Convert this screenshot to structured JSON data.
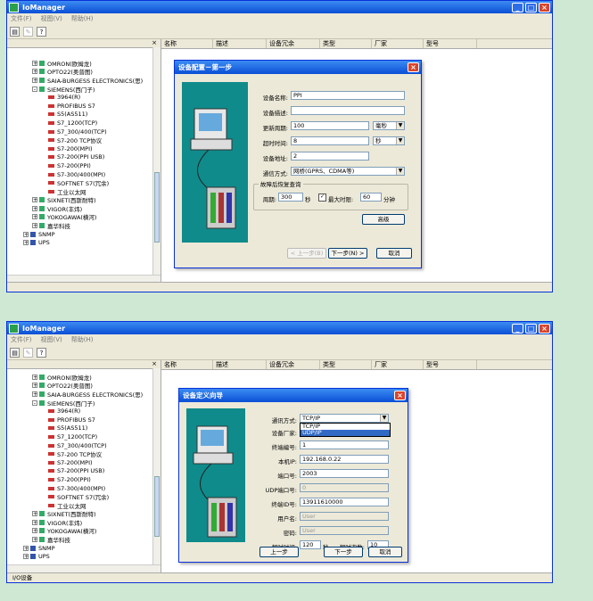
{
  "app": {
    "title": "IoManager"
  },
  "menu": [
    "文件(F)",
    "视图(V)",
    "帮助(H)"
  ],
  "columns": [
    "名称",
    "描述",
    "设备冗余",
    "类型",
    "厂家",
    "型号"
  ],
  "tree": {
    "close_btn": "×",
    "items": [
      {
        "label": "OMRON(欧姆龙)",
        "level": 1,
        "exp": "+"
      },
      {
        "label": "OPTO22(奥普图)",
        "level": 1,
        "exp": "+"
      },
      {
        "label": "SAIA-BURGESS ELECTRONICS(思)",
        "level": 1,
        "exp": "+"
      },
      {
        "label": "SIEMENS(西门子)",
        "level": 1,
        "exp": "-"
      },
      {
        "label": "3964(R)",
        "level": 2
      },
      {
        "label": "PROFIBUS S7",
        "level": 2
      },
      {
        "label": "S5(AS511)",
        "level": 2
      },
      {
        "label": "S7_1200(TCP)",
        "level": 2
      },
      {
        "label": "S7_300/400(TCP)",
        "level": 2
      },
      {
        "label": "S7-200 TCP协议",
        "level": 2
      },
      {
        "label": "S7-200(MPI)",
        "level": 2
      },
      {
        "label": "S7-200(PPI USB)",
        "level": 2
      },
      {
        "label": "S7-200(PPI)",
        "level": 2
      },
      {
        "label": "S7-300/400(MPI)",
        "level": 2
      },
      {
        "label": "SOFTNET S7(冗余)",
        "level": 2
      },
      {
        "label": "工业以太网",
        "level": 2
      },
      {
        "label": "SIXNET(西斯耐特)",
        "level": 1,
        "exp": "+"
      },
      {
        "label": "VIGOR(丰炜)",
        "level": 1,
        "exp": "+"
      },
      {
        "label": "YOKOGAWA(横河)",
        "level": 1,
        "exp": "+"
      },
      {
        "label": "嘉华科技",
        "level": 1,
        "exp": "+"
      },
      {
        "label": "SNMP",
        "level": 0,
        "exp": "+"
      },
      {
        "label": "UPS",
        "level": 0,
        "exp": "+"
      }
    ]
  },
  "dialog1": {
    "title": "设备配置－第一步",
    "name_label": "设备名称:",
    "name_value": "PPI",
    "desc_label": "设备描述:",
    "desc_value": "",
    "cycle_label": "更新周期:",
    "cycle_value": "100",
    "cycle_unit": "毫秒",
    "timeout_label": "超时时间:",
    "timeout_value": "8",
    "timeout_unit": "秒",
    "addr_label": "设备地址:",
    "addr_value": "2",
    "comm_label": "通信方式:",
    "comm_value": "网桥(GPRS、CDMA等)",
    "group_label": "故障后恢复查询",
    "period_label": "周期:",
    "period_value": "300",
    "period_unit": "秒",
    "maxtime_label": "最大时限:",
    "maxtime_value": "60",
    "maxtime_unit": "分钟",
    "advanced_btn": "高级",
    "prev_btn": "< 上一步(B)",
    "next_btn": "下一步(N) >",
    "cancel_btn": "取消"
  },
  "dialog2": {
    "title": "设备定义向导",
    "comm_label": "通讯方式:",
    "comm_value": "TCP/IP",
    "comm_options": [
      "TCP/IP",
      "UDP/IP"
    ],
    "vendor_label": "设备厂家:",
    "term_no_label": "终端编号:",
    "term_no_value": "1",
    "local_ip_label": "本机IP:",
    "local_ip_value": "192.168.0.22",
    "port_label": "端口号:",
    "port_value": "2003",
    "udp_port_label": "UDP端口号:",
    "udp_port_value": "0",
    "term_id_label": "终端ID号:",
    "term_id_value": "13911610000",
    "user_label": "用户名:",
    "user_value": "User",
    "pwd_label": "密码:",
    "pwd_value": "User",
    "timeout_label": "超时时间:",
    "timeout_value": "120",
    "timeout_unit": "秒",
    "retry_label": "超时次数:",
    "retry_value": "10",
    "prev_btn": "上一步",
    "next_btn": "下一步",
    "cancel_btn": "取消"
  },
  "status": {
    "bottom_tab": "I/O设备"
  }
}
